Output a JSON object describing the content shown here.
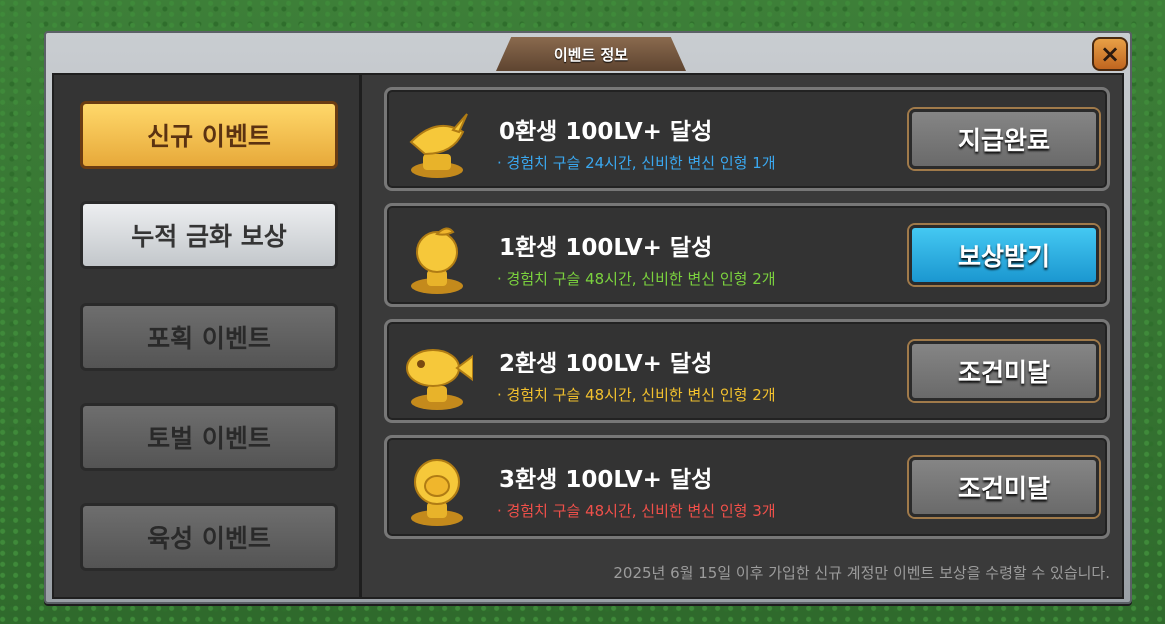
{
  "window": {
    "title": "이벤트 정보",
    "close_icon": "×"
  },
  "sidebar": {
    "items": [
      {
        "label": "신규 이벤트",
        "state": "active"
      },
      {
        "label": "누적 금화 보상",
        "state": "normal"
      },
      {
        "label": "포획 이벤트",
        "state": "disabled"
      },
      {
        "label": "토벌 이벤트",
        "state": "disabled"
      },
      {
        "label": "육성 이벤트",
        "state": "disabled"
      }
    ]
  },
  "events": [
    {
      "title": "0환생 100LV+ 달성",
      "desc": "· 경험치 구슬 24시간, 신비한 변신 인형 1개",
      "desc_color": "#3aa8f0",
      "button": "지급완료",
      "button_style": "gray",
      "icon": "carrot-trophy-icon"
    },
    {
      "title": "1환생 100LV+ 달성",
      "desc": "· 경험치 구슬 48시간, 신비한 변신 인형 2개",
      "desc_color": "#7bd23e",
      "button": "보상받기",
      "button_style": "blue",
      "icon": "apple-trophy-icon"
    },
    {
      "title": "2환생 100LV+ 달성",
      "desc": "· 경험치 구슬 48시간, 신비한 변신 인형 2개",
      "desc_color": "#f2c12e",
      "button": "조건미달",
      "button_style": "gray",
      "icon": "fish-trophy-icon"
    },
    {
      "title": "3환생 100LV+ 달성",
      "desc": "· 경험치 구슬 48시간, 신비한 변신 인형 3개",
      "desc_color": "#f0504a",
      "button": "조건미달",
      "button_style": "gray",
      "icon": "sheep-trophy-icon"
    }
  ],
  "footer": {
    "note": "2025년 6월 15일 이후 가입한 신규 계정만 이벤트 보상을 수령할 수 있습니다."
  },
  "colors": {
    "gold": "#e7a93a",
    "blue": "#1b97d0",
    "panel": "#3a3a3a"
  }
}
